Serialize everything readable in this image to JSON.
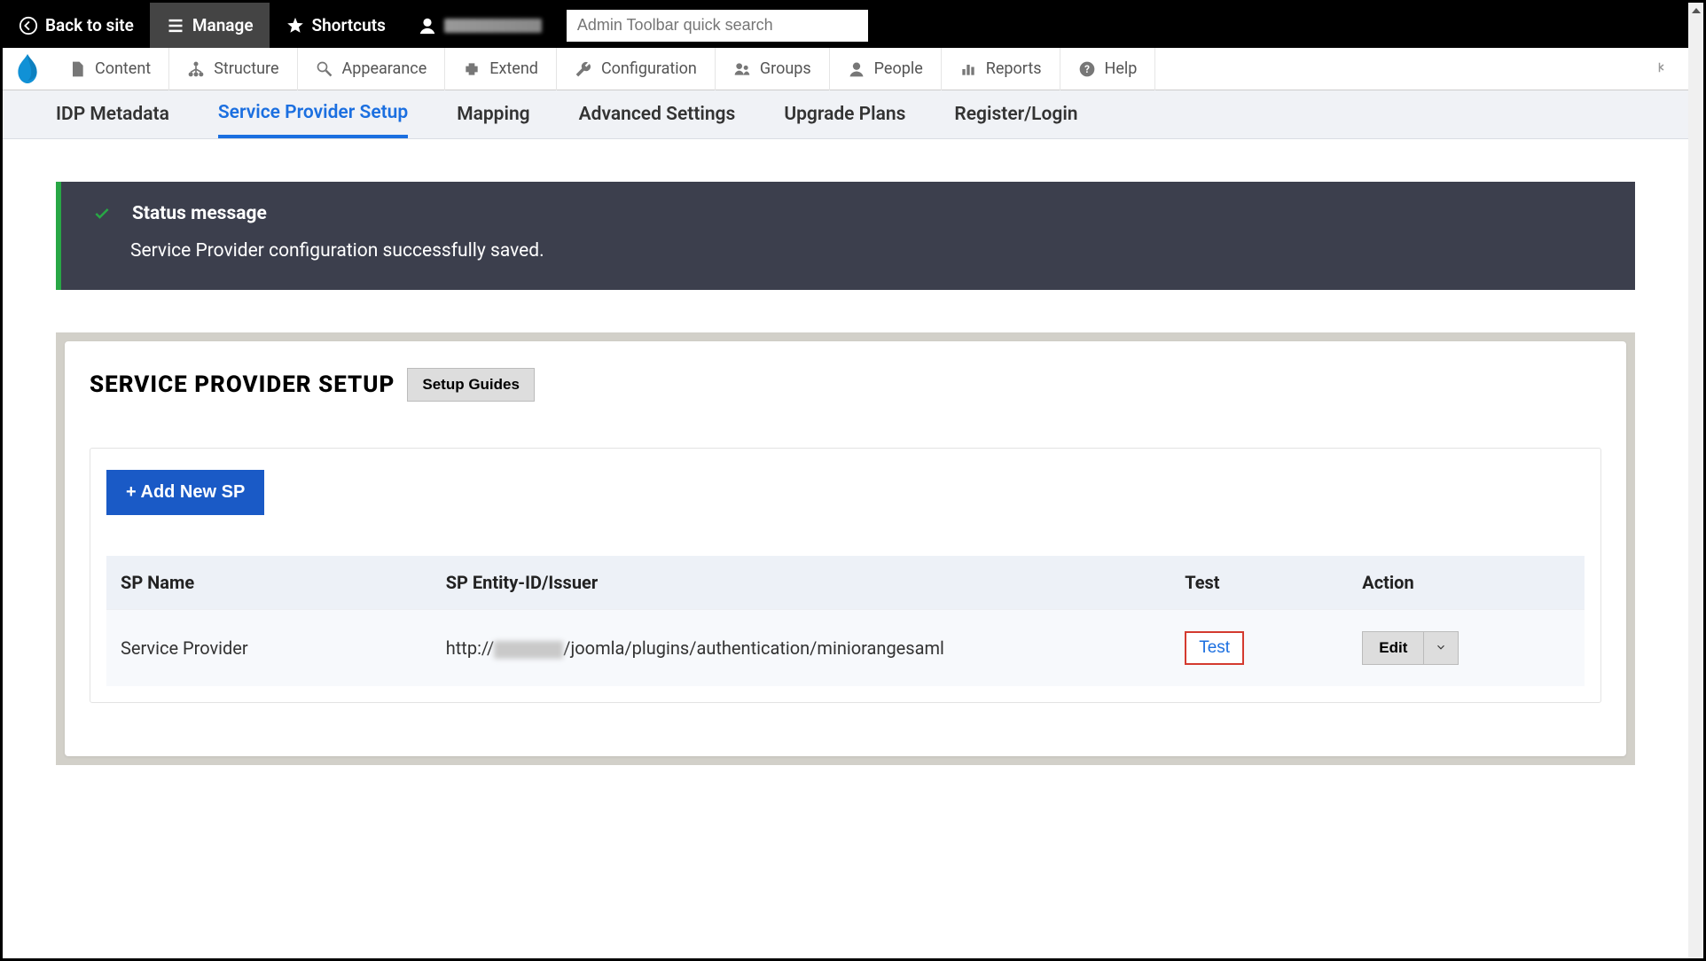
{
  "toolbar": {
    "back": "Back to site",
    "manage": "Manage",
    "shortcuts": "Shortcuts",
    "search_placeholder": "Admin Toolbar quick search"
  },
  "admin_menu": {
    "items": [
      "Content",
      "Structure",
      "Appearance",
      "Extend",
      "Configuration",
      "Groups",
      "People",
      "Reports",
      "Help"
    ]
  },
  "tabs": {
    "items": [
      "IDP Metadata",
      "Service Provider Setup",
      "Mapping",
      "Advanced Settings",
      "Upgrade Plans",
      "Register/Login"
    ],
    "active_index": 1
  },
  "status": {
    "title": "Status message",
    "body": "Service Provider configuration successfully saved."
  },
  "panel": {
    "title": "SERVICE PROVIDER SETUP",
    "setup_guides": "Setup Guides",
    "add_new_sp": "+ Add New SP",
    "table": {
      "headers": [
        "SP Name",
        "SP Entity-ID/Issuer",
        "Test",
        "Action"
      ],
      "row": {
        "sp_name": "Service Provider",
        "entity_prefix": "http://",
        "entity_suffix": "/joomla/plugins/authentication/miniorangesaml",
        "test": "Test",
        "edit": "Edit"
      }
    }
  }
}
